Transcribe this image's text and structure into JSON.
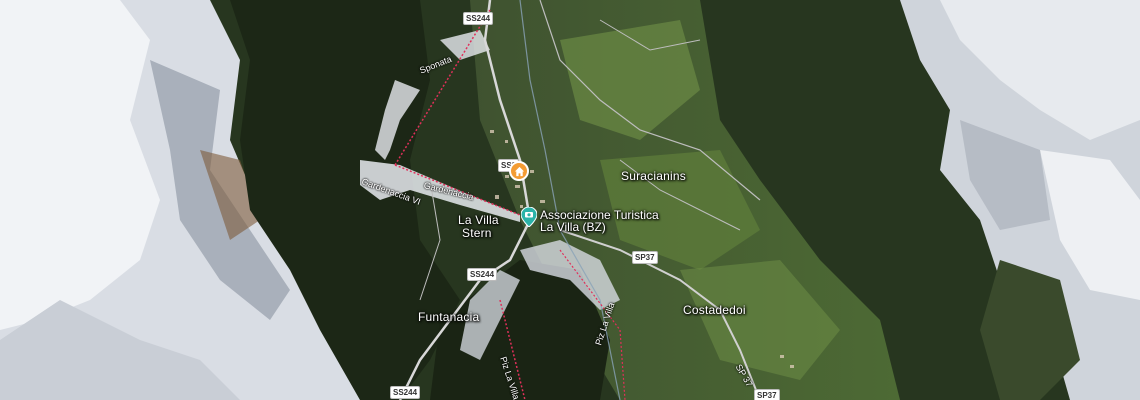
{
  "places": {
    "la_villa": "La Villa",
    "stern": "Stern",
    "suracianins": "Suracianins",
    "funtanacia": "Funtanacia",
    "costadedoi": "Costadedoi"
  },
  "poi": {
    "tourism_name_line1": "Associazione Turistica",
    "tourism_name_line2": "La Villa (BZ)"
  },
  "lifts": {
    "sponata": "Sponata",
    "gardenaccia": "Gardenaccia",
    "gardenaccia_vi": "Gardenaccia VI",
    "piz_la_villa": "Piz La Villa",
    "piz_la_villa_2": "Piz La Villa"
  },
  "roads": {
    "ss244_top": "SS244",
    "ss244_mid": "SS244",
    "ss244_bottom": "SS244",
    "sp37_mid": "SP37",
    "sp37_bottom": "SP37",
    "sp37_diag": "SP 37",
    "ss_home": "SS2"
  },
  "icons": {
    "home_pin": "home-icon",
    "info_pin": "camera-icon"
  },
  "colors": {
    "snow": "#e9edf2",
    "forest": "#253520",
    "meadow": "#5e7a3a",
    "road": "#cfcfcf",
    "lift": "#e0305a",
    "home_pin": "#f39c33",
    "info_pin": "#2bb3a8"
  }
}
